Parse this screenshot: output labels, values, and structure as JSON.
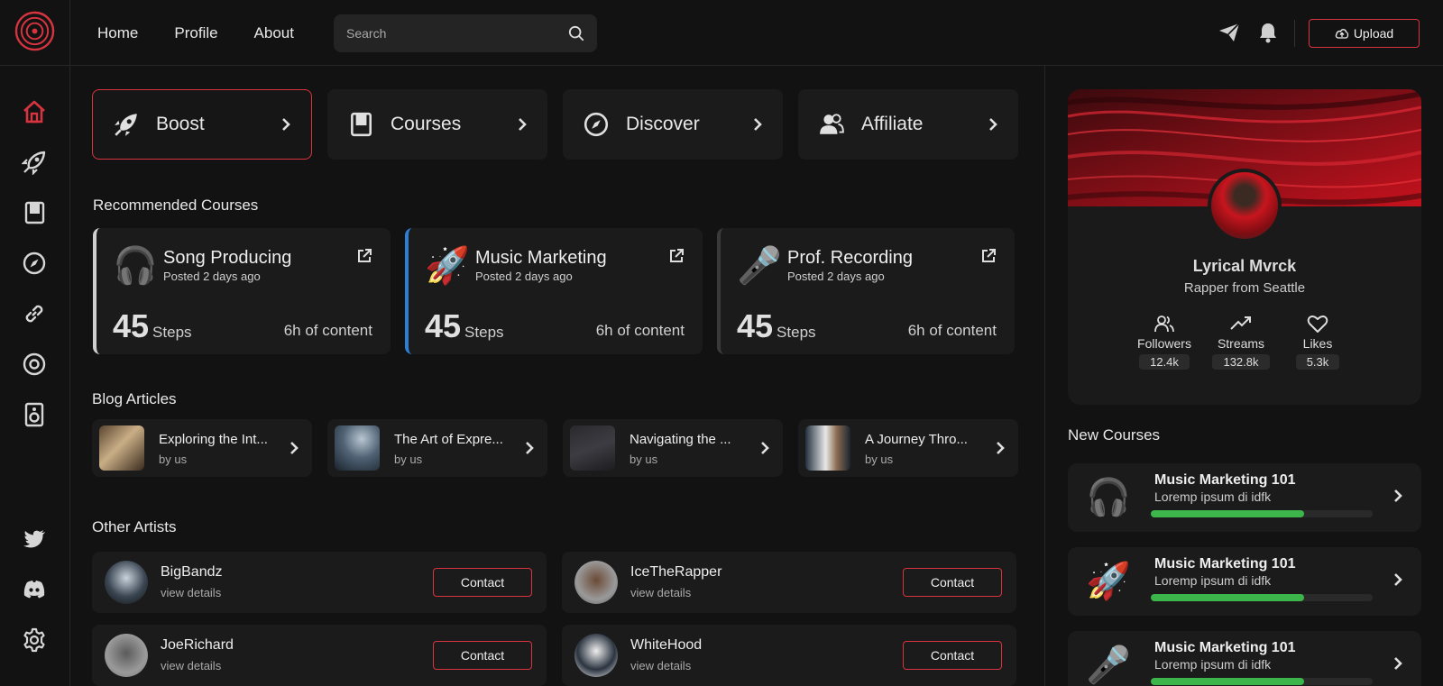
{
  "topbar": {
    "nav": [
      "Home",
      "Profile",
      "About"
    ],
    "search_placeholder": "Search",
    "upload_label": "Upload"
  },
  "quick_actions": [
    {
      "label": "Boost",
      "icon": "rocket-icon"
    },
    {
      "label": "Courses",
      "icon": "book-icon"
    },
    {
      "label": "Discover",
      "icon": "compass-icon"
    },
    {
      "label": "Affiliate",
      "icon": "users-icon"
    }
  ],
  "recommended": {
    "title": "Recommended Courses",
    "items": [
      {
        "emoji": "🎧",
        "title": "Song Producing",
        "posted": "Posted 2 days ago",
        "steps": "45",
        "steps_label": "Steps",
        "content": "6h of content",
        "accent": "#cfcfcf"
      },
      {
        "emoji": "🚀",
        "title": "Music Marketing",
        "posted": "Posted 2 days ago",
        "steps": "45",
        "steps_label": "Steps",
        "content": "6h of content",
        "accent": "#2d7fd3"
      },
      {
        "emoji": "🎤",
        "title": "Prof. Recording",
        "posted": "Posted 2 days ago",
        "steps": "45",
        "steps_label": "Steps",
        "content": "6h of content",
        "accent": "#3a3a3a"
      }
    ]
  },
  "blog": {
    "title": "Blog Articles",
    "items": [
      {
        "title": "Exploring the Int...",
        "by": "by us"
      },
      {
        "title": "The Art of Expre...",
        "by": "by us"
      },
      {
        "title": "Navigating the ...",
        "by": "by us"
      },
      {
        "title": "A Journey Thro...",
        "by": "by us"
      }
    ]
  },
  "artists": {
    "title": "Other Artists",
    "contact_label": "Contact",
    "items": [
      {
        "name": "BigBandz",
        "sub": "view details"
      },
      {
        "name": "IceTheRapper",
        "sub": "view details"
      },
      {
        "name": "JoeRichard",
        "sub": "view details"
      },
      {
        "name": "WhiteHood",
        "sub": "view details"
      }
    ]
  },
  "profile": {
    "name": "Lyrical Mvrck",
    "bio": "Rapper from Seattle",
    "stats": [
      {
        "label": "Followers",
        "value": "12.4k"
      },
      {
        "label": "Streams",
        "value": "132.8k"
      },
      {
        "label": "Likes",
        "value": "5.3k"
      }
    ]
  },
  "new_courses": {
    "title": "New Courses",
    "items": [
      {
        "emoji": "🎧",
        "title": "Music Marketing 101",
        "sub": "Loremp ipsum di idfk",
        "progress": 0.69
      },
      {
        "emoji": "🚀",
        "title": "Music Marketing 101",
        "sub": "Loremp ipsum di idfk",
        "progress": 0.69
      },
      {
        "emoji": "🎤",
        "title": "Music Marketing 101",
        "sub": "Loremp ipsum di idfk",
        "progress": 0.69
      }
    ]
  },
  "colors": {
    "accent": "#d8343f",
    "progress": "#3cb54a",
    "blue": "#2d7fd3"
  }
}
